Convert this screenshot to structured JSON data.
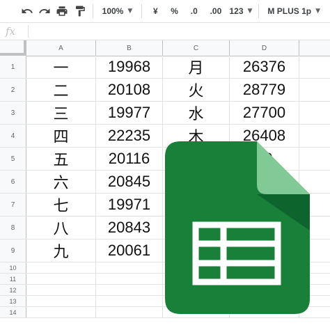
{
  "toolbar": {
    "zoom": "100%",
    "currency": "¥",
    "percent": "%",
    "decrease_decimal": ".0",
    "increase_decimal": ".00",
    "more_formats": "123",
    "font": "M PLUS 1p"
  },
  "formula_bar": {
    "fx_label": "fx"
  },
  "columns": [
    "A",
    "B",
    "C",
    "D"
  ],
  "rows": [
    {
      "n": "1",
      "a": "一",
      "b": "19968",
      "c": "月",
      "d": "26376"
    },
    {
      "n": "2",
      "a": "二",
      "b": "20108",
      "c": "火",
      "d": "28779"
    },
    {
      "n": "3",
      "a": "三",
      "b": "19977",
      "c": "水",
      "d": "27700"
    },
    {
      "n": "4",
      "a": "四",
      "b": "22235",
      "c": "木",
      "d": "26408"
    },
    {
      "n": "5",
      "a": "五",
      "b": "20116",
      "c": "",
      "d": "29"
    },
    {
      "n": "6",
      "a": "六",
      "b": "20845",
      "c": "",
      "d": ""
    },
    {
      "n": "7",
      "a": "七",
      "b": "19971",
      "c": "",
      "d": ""
    },
    {
      "n": "8",
      "a": "八",
      "b": "20843",
      "c": "",
      "d": ""
    },
    {
      "n": "9",
      "a": "九",
      "b": "20061",
      "c": "",
      "d": ""
    },
    {
      "n": "10",
      "a": "",
      "b": "",
      "c": "",
      "d": ""
    },
    {
      "n": "11",
      "a": "",
      "b": "",
      "c": "",
      "d": ""
    },
    {
      "n": "12",
      "a": "",
      "b": "",
      "c": "",
      "d": ""
    },
    {
      "n": "13",
      "a": "",
      "b": "",
      "c": "",
      "d": ""
    },
    {
      "n": "14",
      "a": "",
      "b": "",
      "c": "",
      "d": ""
    }
  ],
  "icons": {
    "undo": "undo-icon",
    "redo": "redo-icon",
    "print": "print-icon",
    "paint_format": "paint-format-icon",
    "logo": "google-sheets-logo"
  },
  "colors": {
    "logo_green": "#188038",
    "logo_fold_light": "#81c995",
    "logo_fold_dark": "#0d652d"
  }
}
